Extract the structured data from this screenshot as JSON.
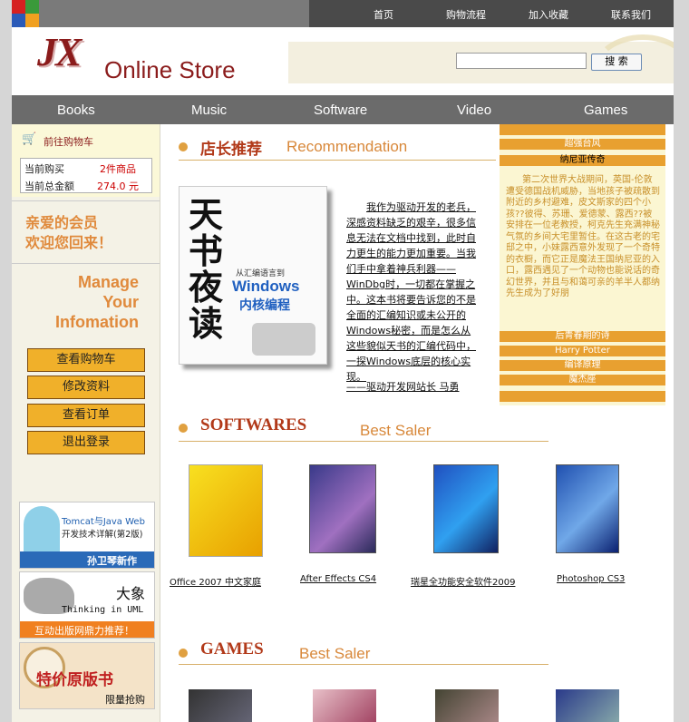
{
  "top_nav": [
    "首页",
    "购物流程",
    "加入收藏",
    "联系我们"
  ],
  "logo": {
    "mark": "JX",
    "text": "Online Store"
  },
  "search": {
    "value": "",
    "button": "搜 索"
  },
  "categories": [
    "Books",
    "Music",
    "Software",
    "Video",
    "Games"
  ],
  "cart": {
    "title": "前往购物车",
    "rows": [
      {
        "label": "当前购买",
        "value": "2件商品"
      },
      {
        "label": "当前总金额",
        "value": "274.0 元"
      }
    ]
  },
  "welcome": [
    "亲爱的会员",
    "欢迎您回来！"
  ],
  "manage": [
    "Manage",
    "Your",
    "Infomation"
  ],
  "menu": [
    "查看购物车",
    "修改资料",
    "查看订单",
    "退出登录"
  ],
  "ads": [
    {
      "lines": [
        "Tomcat与Java Web",
        "开发技术详解(第2版)",
        "孙卫琴新作"
      ]
    },
    {
      "lines": [
        "大象",
        "Thinking in UML",
        "互动出版网鼎力推荐！"
      ]
    },
    {
      "lines": [
        "特价原版书",
        "限量抢购"
      ]
    }
  ],
  "recommendation": {
    "title_cn": "店长推荐",
    "title_en": "Recommendation",
    "book": {
      "title_cn": "天书夜读",
      "subtitle": "从汇编语言到",
      "big": "Windows",
      "big2": "内核编程"
    },
    "text": "我作为驱动开发的老兵，深感资料缺乏的艰辛，很多信息无法在文档中找到，此时自力更生的能力更加重要。当我们手中拿着神兵利器——WinDbg时，一切都在掌握之中。这本书将要告诉您的不是全面的汇编知识或未公开的Windows秘密，而是怎么从这些貌似天书的汇编代码中，一探Windows底层的核心实现。",
    "author": "——驱动开发网站长 马勇"
  },
  "right_column": {
    "items_top": [
      "超强台风",
      "纳尼亚传奇"
    ],
    "text": "第二次世界大战期间，英国-伦敦遭受德国战机威胁，当地孩子被疏散到附近的乡村避难，皮文斯家的四个小孩??彼得、苏珊、爱德蒙、露西??被安排在一位老教授，柯克先生充满神秘气氛的乡间大宅里暂住。在这古老的宅邸之中，小妹露西意外发现了一个奇特的衣橱，而它正是魔法王国纳尼亚的入口，露西遇见了一个动物也能说话的奇幻世界，并且与和蔼可亲的羊半人都纳先生成为了好朋",
    "items_bottom": [
      "后青春期的诗",
      "Harry Potter",
      "编译原理",
      "魔杰座",
      ""
    ]
  },
  "softwares": {
    "title_cn": "SOFTWARES",
    "title_en": "Best Saler",
    "items": [
      "Office 2007 中文家庭",
      "After Effects CS4",
      "瑞星全功能安全软件2009",
      "Photoshop CS3"
    ]
  },
  "games": {
    "title_cn": "GAMES",
    "title_en": "Best Saler"
  }
}
